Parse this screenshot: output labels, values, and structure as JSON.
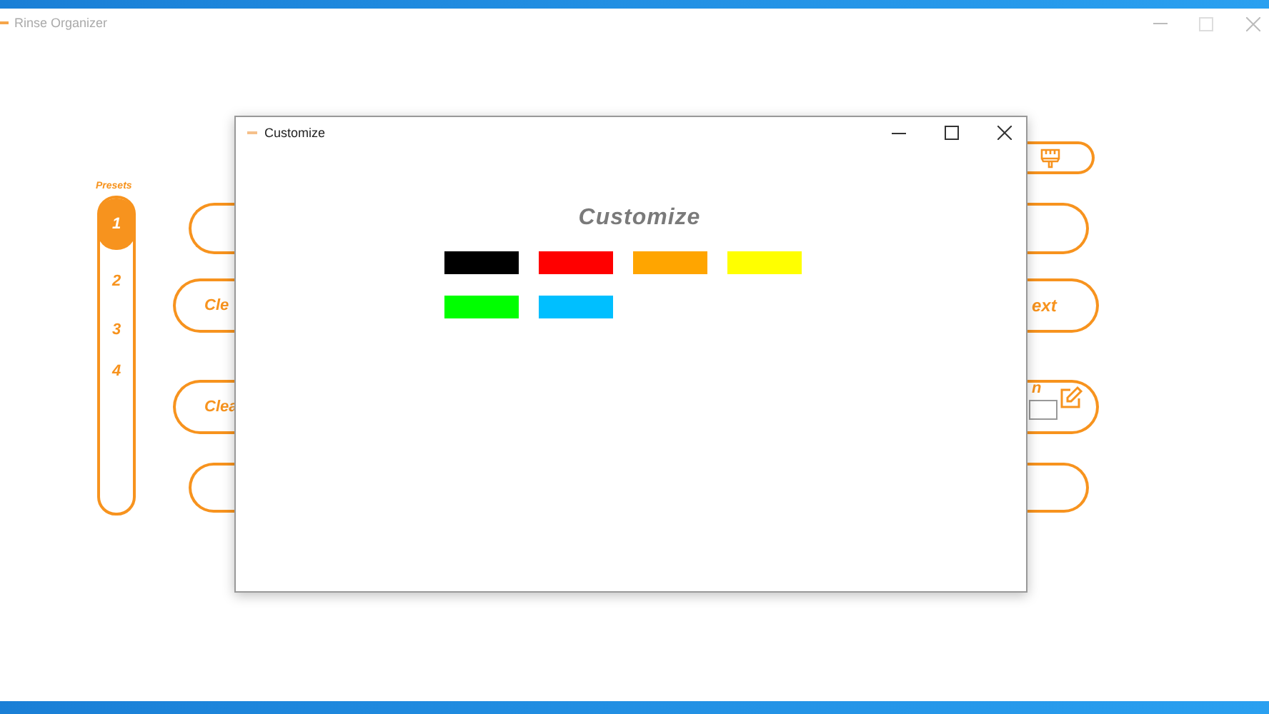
{
  "window": {
    "title": "Rinse Organizer"
  },
  "presets": {
    "label": "Presets",
    "items": [
      {
        "label": "1",
        "selected": true
      },
      {
        "label": "2",
        "selected": false
      },
      {
        "label": "3",
        "selected": false
      },
      {
        "label": "4",
        "selected": false
      }
    ]
  },
  "left_buttons": [
    {
      "label": "Cle"
    },
    {
      "label": "Clea"
    }
  ],
  "right_buttons": [
    {
      "label": "ext"
    },
    {
      "label": "n"
    }
  ],
  "dialog": {
    "title": "Customize",
    "heading": "Customize",
    "swatches": [
      {
        "color": "#000000"
      },
      {
        "color": "#ff0000"
      },
      {
        "color": "#ffa500"
      },
      {
        "color": "#ffff00"
      },
      {
        "color": "#00ff00"
      },
      {
        "color": "#00bfff"
      }
    ]
  }
}
